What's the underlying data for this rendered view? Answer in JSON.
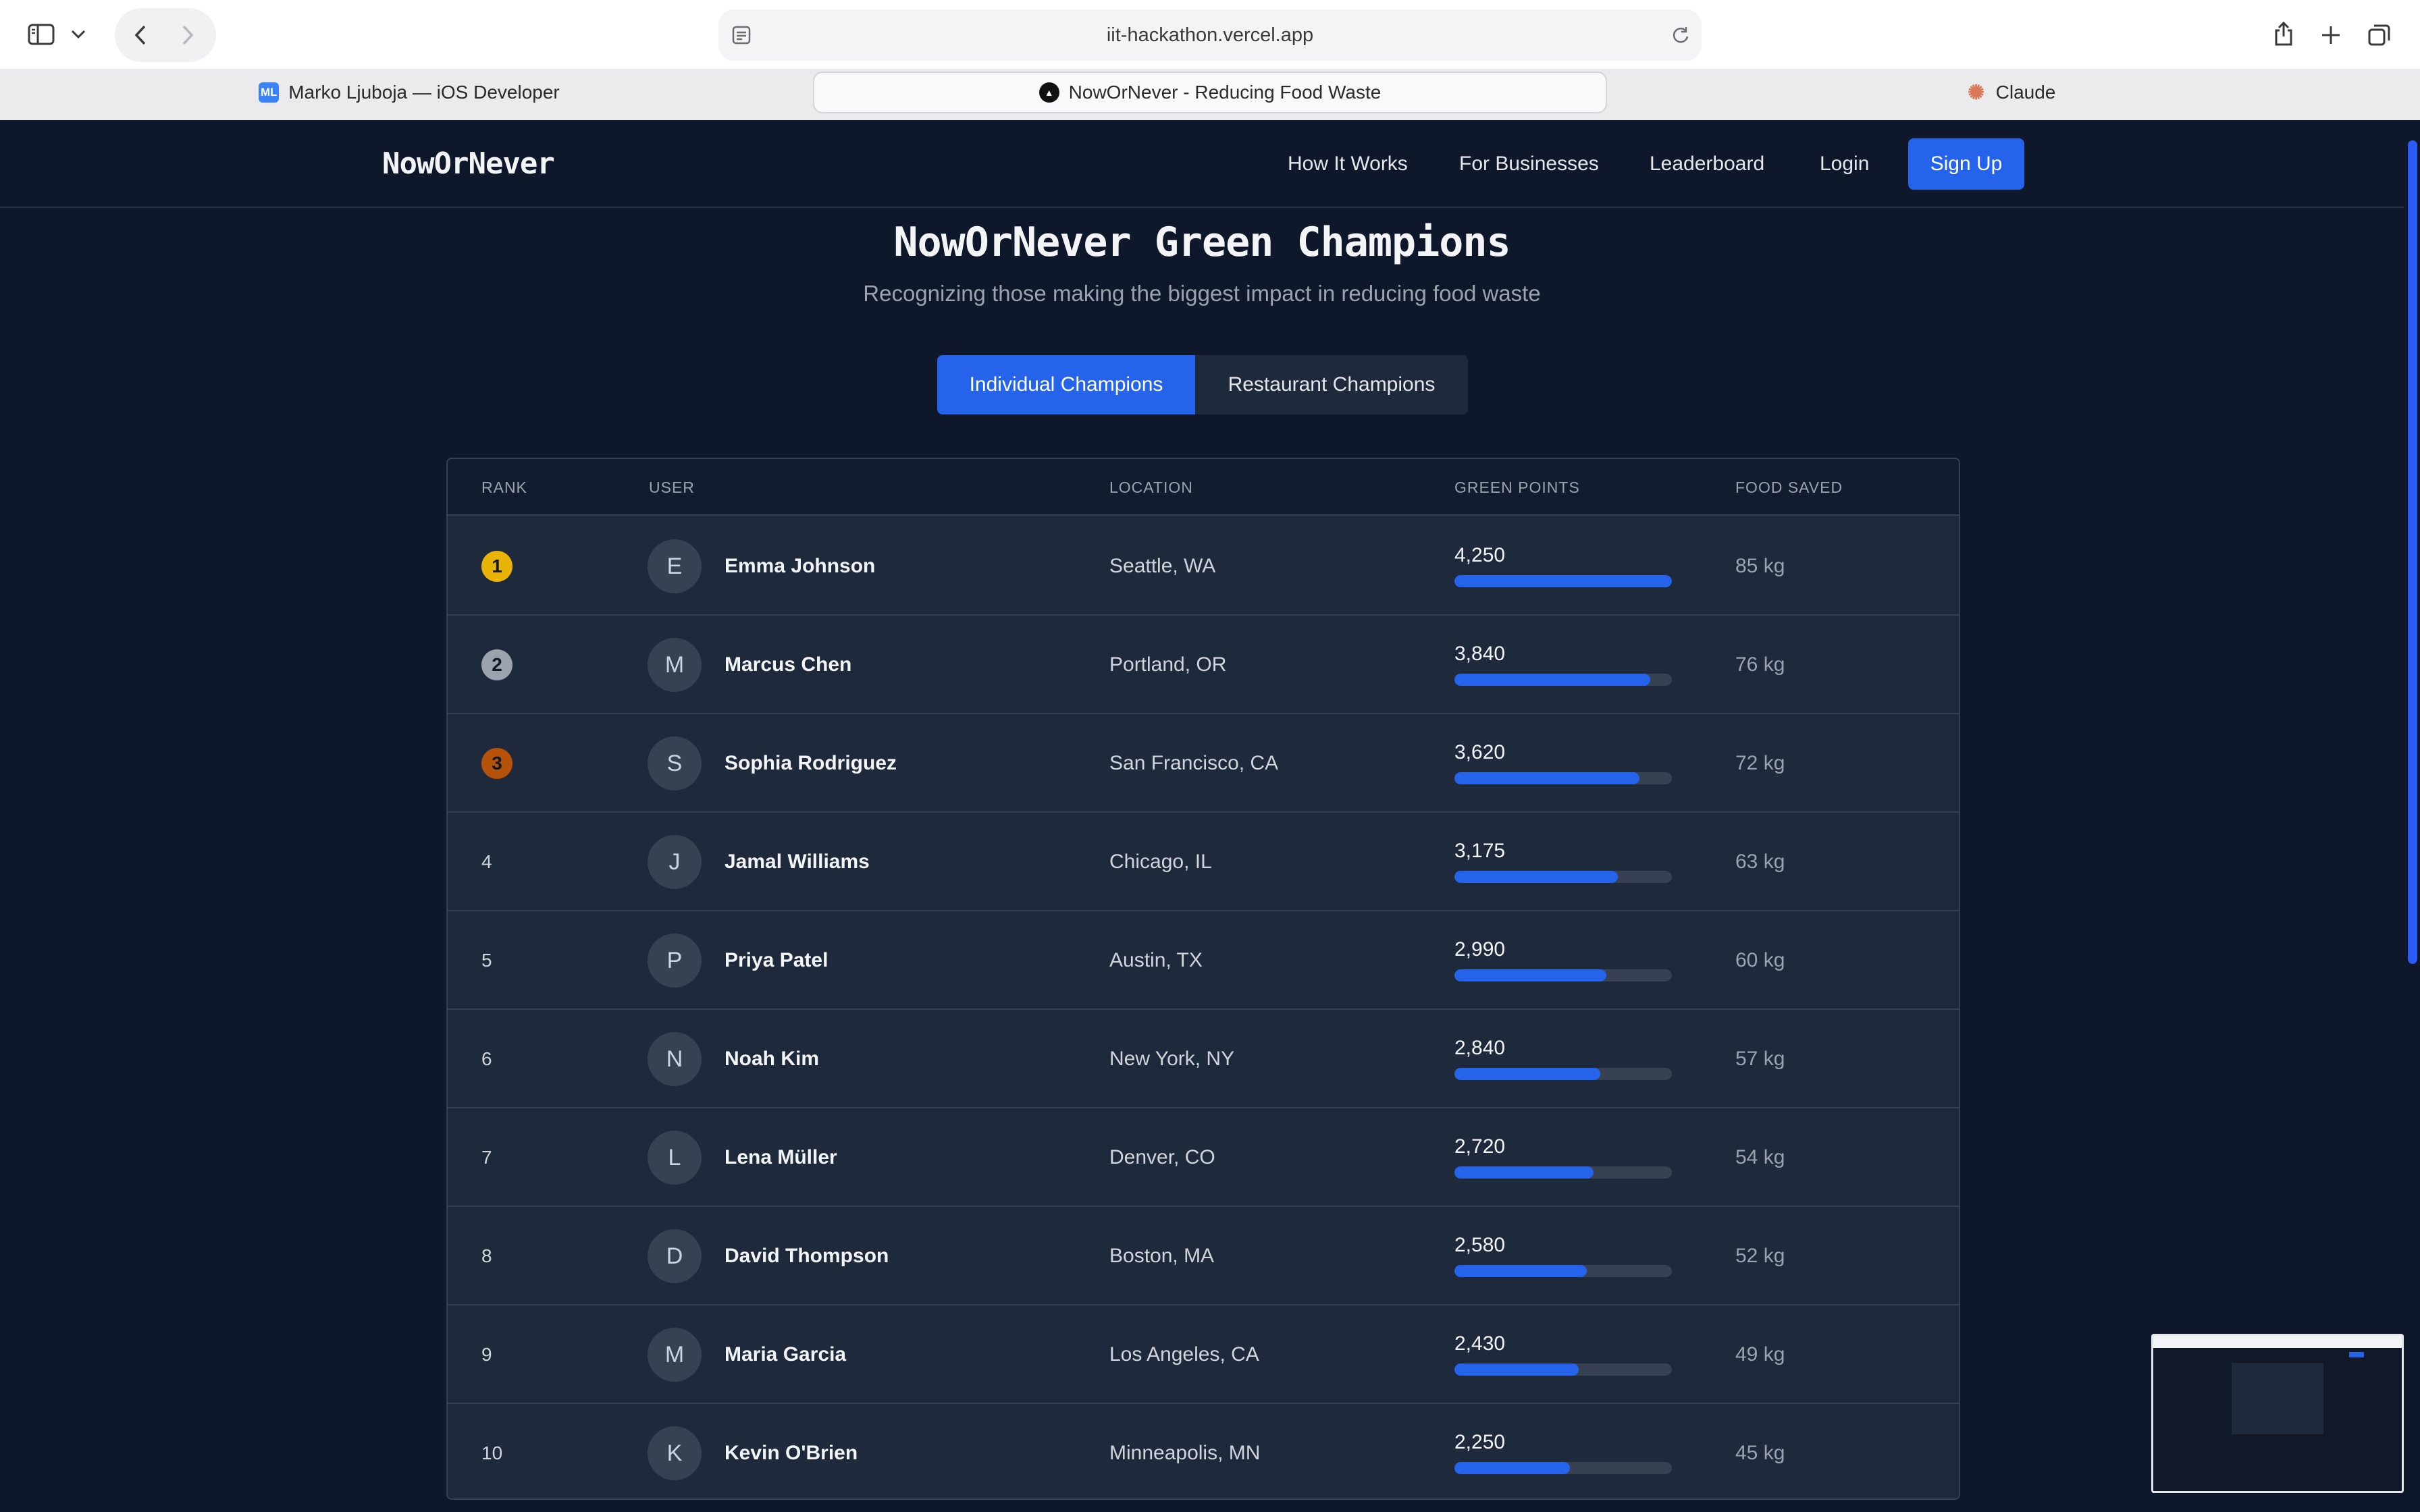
{
  "browser": {
    "url": "iit-hackathon.vercel.app",
    "tabs": [
      {
        "favicon_text": "ML",
        "favicon_color": "#3b82f6",
        "title": "Marko Ljuboja — iOS Developer",
        "active": false
      },
      {
        "favicon_text": "▲",
        "favicon_color": "#111111",
        "title": "NowOrNever - Reducing Food Waste",
        "active": true
      },
      {
        "favicon_text": "✺",
        "favicon_color": "#d97757",
        "title": "Claude",
        "active": false
      }
    ]
  },
  "site": {
    "logo": "NowOrNever",
    "nav": {
      "how_it_works": "How It Works",
      "for_businesses": "For Businesses",
      "leaderboard": "Leaderboard",
      "login": "Login",
      "signup": "Sign Up"
    }
  },
  "hero": {
    "title": "NowOrNever Green Champions",
    "subtitle": "Recognizing those making the biggest impact in reducing food waste"
  },
  "toggle": {
    "individual": "Individual Champions",
    "restaurant": "Restaurant Champions",
    "active": "individual"
  },
  "table": {
    "headers": {
      "rank": "RANK",
      "user": "USER",
      "location": "LOCATION",
      "points": "GREEN POINTS",
      "saved": "FOOD SAVED"
    },
    "rows": [
      {
        "rank": "1",
        "initial": "E",
        "name": "Emma Johnson",
        "location": "Seattle, WA",
        "points": "4,250",
        "progress": 1.0,
        "saved": "85 kg"
      },
      {
        "rank": "2",
        "initial": "M",
        "name": "Marcus Chen",
        "location": "Portland, OR",
        "points": "3,840",
        "progress": 0.9,
        "saved": "76 kg"
      },
      {
        "rank": "3",
        "initial": "S",
        "name": "Sophia Rodriguez",
        "location": "San Francisco, CA",
        "points": "3,620",
        "progress": 0.85,
        "saved": "72 kg"
      },
      {
        "rank": "4",
        "initial": "J",
        "name": "Jamal Williams",
        "location": "Chicago, IL",
        "points": "3,175",
        "progress": 0.75,
        "saved": "63 kg"
      },
      {
        "rank": "5",
        "initial": "P",
        "name": "Priya Patel",
        "location": "Austin, TX",
        "points": "2,990",
        "progress": 0.7,
        "saved": "60 kg"
      },
      {
        "rank": "6",
        "initial": "N",
        "name": "Noah Kim",
        "location": "New York, NY",
        "points": "2,840",
        "progress": 0.67,
        "saved": "57 kg"
      },
      {
        "rank": "7",
        "initial": "L",
        "name": "Lena Müller",
        "location": "Denver, CO",
        "points": "2,720",
        "progress": 0.64,
        "saved": "54 kg"
      },
      {
        "rank": "8",
        "initial": "D",
        "name": "David Thompson",
        "location": "Boston, MA",
        "points": "2,580",
        "progress": 0.61,
        "saved": "52 kg"
      },
      {
        "rank": "9",
        "initial": "M",
        "name": "Maria Garcia",
        "location": "Los Angeles, CA",
        "points": "2,430",
        "progress": 0.57,
        "saved": "49 kg"
      },
      {
        "rank": "10",
        "initial": "K",
        "name": "Kevin O'Brien",
        "location": "Minneapolis, MN",
        "points": "2,250",
        "progress": 0.53,
        "saved": "45 kg"
      }
    ]
  },
  "colors": {
    "accent": "#2563eb",
    "gold": "#eab308",
    "silver": "#9ca3af",
    "bronze": "#b45309",
    "background": "#0f172a",
    "surface": "#1e293b"
  }
}
